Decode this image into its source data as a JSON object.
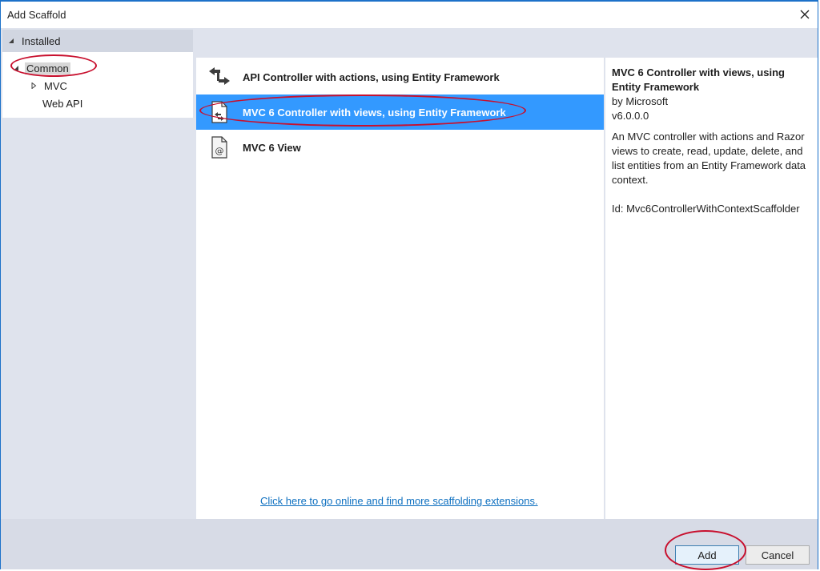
{
  "window": {
    "title": "Add Scaffold"
  },
  "tree": {
    "installed_label": "Installed",
    "common_label": "Common",
    "mvc_label": "MVC",
    "webapi_label": "Web API"
  },
  "list": {
    "items": [
      {
        "label": "API Controller with actions, using Entity Framework",
        "icon": "api-controller-icon"
      },
      {
        "label": "MVC 6 Controller with views, using Entity Framework",
        "icon": "mvc-controller-icon"
      },
      {
        "label": "MVC 6 View",
        "icon": "mvc-view-icon"
      }
    ],
    "selected_index": 1,
    "online_link": "Click here to go online and find more scaffolding extensions."
  },
  "details": {
    "title": "MVC 6 Controller with views, using Entity Framework",
    "author": "by Microsoft",
    "version": "v6.0.0.0",
    "description": "An MVC controller with actions and Razor views to create, read, update, delete, and list entities from an Entity Framework data context.",
    "id": "Id: Mvc6ControllerWithContextScaffolder"
  },
  "buttons": {
    "add": "Add",
    "cancel": "Cancel"
  },
  "colors": {
    "selection": "#3399ff",
    "link": "#0e70c0",
    "annotation": "#c8102e",
    "window_border": "#1c71c9"
  }
}
